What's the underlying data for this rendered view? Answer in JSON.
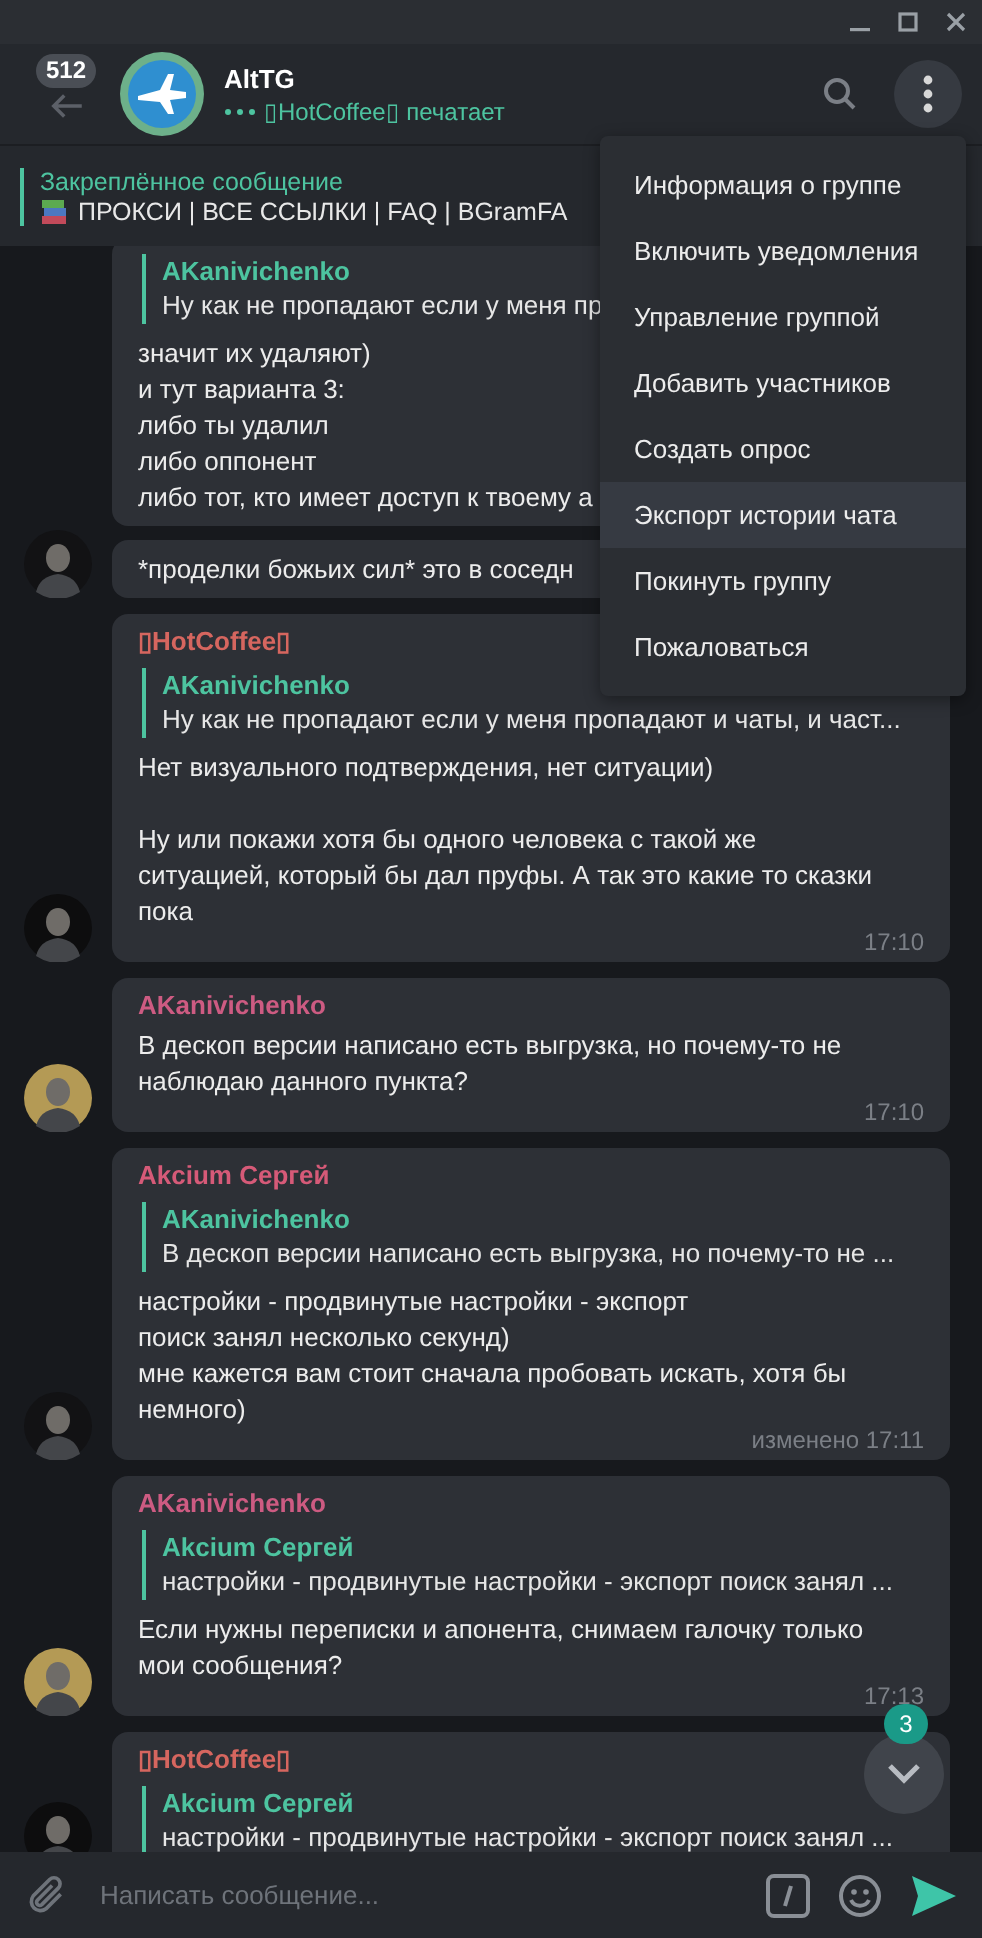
{
  "header": {
    "back_badge": "512",
    "title": "AltTG",
    "status": "▯HotCoffee▯ печатает"
  },
  "pinned": {
    "label": "Закреплённое сообщение",
    "text": "ПРОКСИ | ВСЕ ССЫЛКИ | FAQ | BGramFA"
  },
  "messages": [
    {
      "reply": {
        "name": "AKanivichenko",
        "text": "Ну как не пропадают если у меня пр"
      },
      "text": "значит их удаляют)\nи тут варианта 3:\nлибо ты удалил\nлибо оппонент\nлибо тот, кто имеет доступ к твоему а"
    },
    {
      "avatar": {
        "color": "#121214"
      },
      "text": "*проделки божьих сил* это в соседн"
    },
    {
      "sender": {
        "name": "▯HotCoffee▯",
        "color": "#d6665f"
      },
      "avatar": {
        "color": "#0d0d0e"
      },
      "reply": {
        "name": "AKanivichenko",
        "text": "Ну как не пропадают если у меня пропадают и чаты, и част..."
      },
      "text": "Нет визуального подтверждения, нет ситуации)\n\nНу или покажи хотя бы одного человека с такой же\nситуацией, который бы дал пруфы. А так это какие то сказки\nпока",
      "time": "17:10"
    },
    {
      "sender": {
        "name": "AKanivichenko",
        "color": "#cd5b82"
      },
      "avatar": {
        "color": "#b49a55"
      },
      "text": "В дескоп версии написано есть выгрузка, но почему-то не\nнаблюдаю данного пункта?",
      "time": "17:10"
    },
    {
      "sender": {
        "name": "Akcium Сергей",
        "color": "#d65a78"
      },
      "avatar": {
        "color": "#121214"
      },
      "reply": {
        "name": "AKanivichenko",
        "text": "В дескоп версии написано есть выгрузка, но почему-то не ..."
      },
      "text": "настройки - продвинутые настройки - экспорт\nпоиск занял несколько секунд)\nмне кажется вам стоит сначала пробовать искать, хотя бы\nнемного)",
      "time": "изменено 17:11"
    },
    {
      "sender": {
        "name": "AKanivichenko",
        "color": "#cd5b82"
      },
      "avatar": {
        "color": "#b49a55"
      },
      "reply": {
        "name": "Akcium Сергей",
        "text": "настройки - продвинутые настройки - экспорт поиск занял ..."
      },
      "text": "Если нужны переписки и апонента, снимаем галочку только\nмои сообщения?",
      "time": "17:13"
    },
    {
      "sender": {
        "name": "▯HotCoffee▯",
        "color": "#d6665f"
      },
      "avatar": {
        "color": "#0d0d0e"
      },
      "reply": {
        "name": "Akcium Сергей",
        "text": "настройки - продвинутые настройки - экспорт поиск занял ..."
      }
    }
  ],
  "menu": {
    "items": [
      {
        "label": "Информация о группе",
        "selected": false
      },
      {
        "label": "Включить уведомления",
        "selected": false
      },
      {
        "label": "Управление группой",
        "selected": false
      },
      {
        "label": "Добавить участников",
        "selected": false
      },
      {
        "label": "Создать опрос",
        "selected": false
      },
      {
        "label": "Экспорт истории чата",
        "selected": true
      },
      {
        "label": "Покинуть группу",
        "selected": false
      },
      {
        "label": "Пожаловаться",
        "selected": false
      }
    ]
  },
  "scroll_down": {
    "badge": "3"
  },
  "composer": {
    "placeholder": "Написать сообщение..."
  }
}
